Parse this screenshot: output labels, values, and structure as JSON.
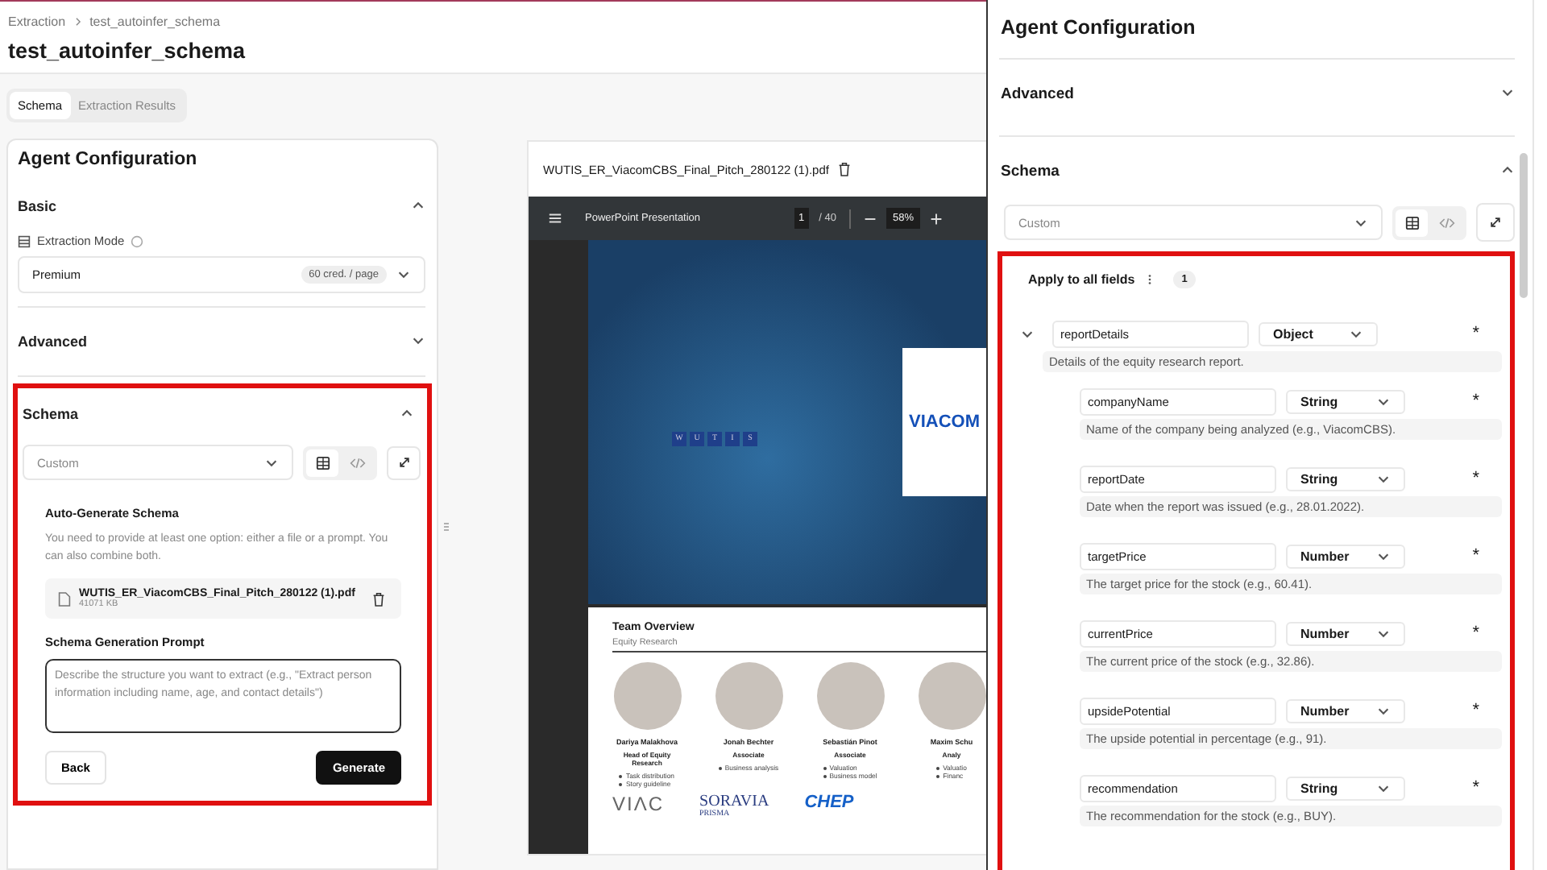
{
  "breadcrumb": [
    "Extraction",
    "test_autoinfer_schema"
  ],
  "title": "test_autoinfer_schema",
  "tabs": [
    {
      "label": "Schema",
      "selected": true
    },
    {
      "label": "Extraction Results",
      "selected": false
    }
  ],
  "config_panel": {
    "title": "Agent Configuration",
    "basic": {
      "title": "Basic",
      "expanded": true
    },
    "extraction_mode": {
      "label": "Extraction Mode",
      "value": "Premium",
      "badge": "60 cred. / page"
    },
    "advanced": {
      "title": "Advanced",
      "expanded": false
    },
    "schema": {
      "title": "Schema",
      "expanded": true,
      "preset": "Custom",
      "view_toggle": [
        {
          "kind": "table",
          "selected": true
        },
        {
          "kind": "code",
          "selected": false
        }
      ]
    },
    "auto_generate": {
      "title": "Auto-Generate Schema",
      "description": "You need to provide at least one option: either a file or a prompt. You can also combine both.",
      "file": {
        "name": "WUTIS_ER_ViacomCBS_Final_Pitch_280122 (1).pdf",
        "size": "41071 KB"
      },
      "prompt_label": "Schema Generation Prompt",
      "prompt_placeholder": "Describe the structure you want to extract (e.g., \"Extract person information including name, age, and contact details\")",
      "buttons": [
        {
          "label": "Back",
          "kind": "secondary"
        },
        {
          "label": "Generate",
          "kind": "primary"
        }
      ]
    }
  },
  "document_viewer": {
    "file_name": "WUTIS_ER_ViacomCBS_Final_Pitch_280122 (1).pdf",
    "toolbar": {
      "title": "PowerPoint Presentation",
      "page": "1",
      "page_total": "/ 40",
      "zoom": "58%"
    },
    "cover_slide": {
      "logo_letters": [
        "W",
        "U",
        "T",
        "I",
        "S"
      ],
      "company": "VIACOM"
    },
    "team_slide": {
      "title": "Team Overview",
      "subtitle": "Equity Research",
      "members": [
        {
          "name": "Dariya Malakhova",
          "role": "Head of Equity Research",
          "bullets": [
            "Task distribution",
            "Story guideline"
          ]
        },
        {
          "name": "Jonah Bechter",
          "role": "Associate",
          "bullets": [
            "Business analysis"
          ]
        },
        {
          "name": "Sebastián Pinot",
          "role": "Associate",
          "bullets": [
            "Valuation",
            "Business model"
          ]
        },
        {
          "name": "Maxim Schu",
          "role": "Analy",
          "bullets": [
            "Valuatio",
            "Financ"
          ]
        }
      ],
      "logos": [
        "VIΛC",
        "SORAVIA",
        "PRISMA",
        "CHEP"
      ]
    }
  },
  "schema_panel": {
    "title": "Agent Configuration",
    "sections": [
      {
        "title": "Advanced",
        "expanded": false
      },
      {
        "title": "Schema",
        "expanded": true
      }
    ],
    "preset": "Custom",
    "view_toggle": [
      {
        "kind": "table",
        "selected": true
      },
      {
        "kind": "code",
        "selected": false
      }
    ],
    "apply_all": {
      "label": "Apply to all fields",
      "count": "1"
    },
    "fields": [
      {
        "name": "reportDetails",
        "type": "Object",
        "required": "*",
        "description": "Details of the equity research report.",
        "expanded": true,
        "children": [
          {
            "name": "companyName",
            "type": "String",
            "required": "*",
            "description": "Name of the company being analyzed (e.g., ViacomCBS)."
          },
          {
            "name": "reportDate",
            "type": "String",
            "required": "*",
            "description": "Date when the report was issued (e.g., 28.01.2022)."
          },
          {
            "name": "targetPrice",
            "type": "Number",
            "required": "*",
            "description": "The target price for the stock (e.g., 60.41)."
          },
          {
            "name": "currentPrice",
            "type": "Number",
            "required": "*",
            "description": "The current price of the stock (e.g., 32.86)."
          },
          {
            "name": "upsidePotential",
            "type": "Number",
            "required": "*",
            "description": "The upside potential in percentage (e.g., 91)."
          },
          {
            "name": "recommendation",
            "type": "String",
            "required": "*",
            "description": "The recommendation for the stock (e.g., BUY)."
          }
        ]
      }
    ]
  }
}
